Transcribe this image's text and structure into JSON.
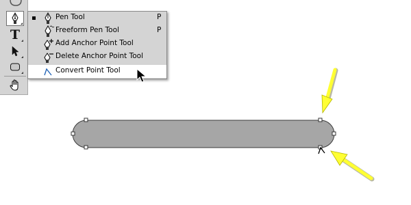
{
  "toolbox": {
    "tools": [
      {
        "name": "pen",
        "icon": "pen-icon",
        "active": true
      },
      {
        "name": "type",
        "icon": "type-icon",
        "glyph": "T"
      },
      {
        "name": "path-selection",
        "icon": "arrow-icon"
      },
      {
        "name": "shape",
        "icon": "rounded-rect-icon"
      },
      {
        "name": "hand",
        "icon": "hand-icon"
      }
    ]
  },
  "flyout": {
    "items": [
      {
        "label": "Pen Tool",
        "shortcut": "P",
        "icon": "pen-icon",
        "selected": true
      },
      {
        "label": "Freeform Pen Tool",
        "shortcut": "P",
        "icon": "freeform-pen-icon"
      },
      {
        "label": "Add Anchor Point Tool",
        "icon": "add-anchor-point-icon"
      },
      {
        "label": "Delete Anchor Point Tool",
        "icon": "delete-anchor-point-icon"
      },
      {
        "label": "Convert Point Tool",
        "icon": "convert-point-icon",
        "hovered": true
      }
    ]
  },
  "canvas": {
    "shape": "rounded-rectangle-path",
    "fill_color": "#a6a6a6",
    "stroke_color": "#3a3a3a",
    "annotation_color": "#ffff33"
  }
}
